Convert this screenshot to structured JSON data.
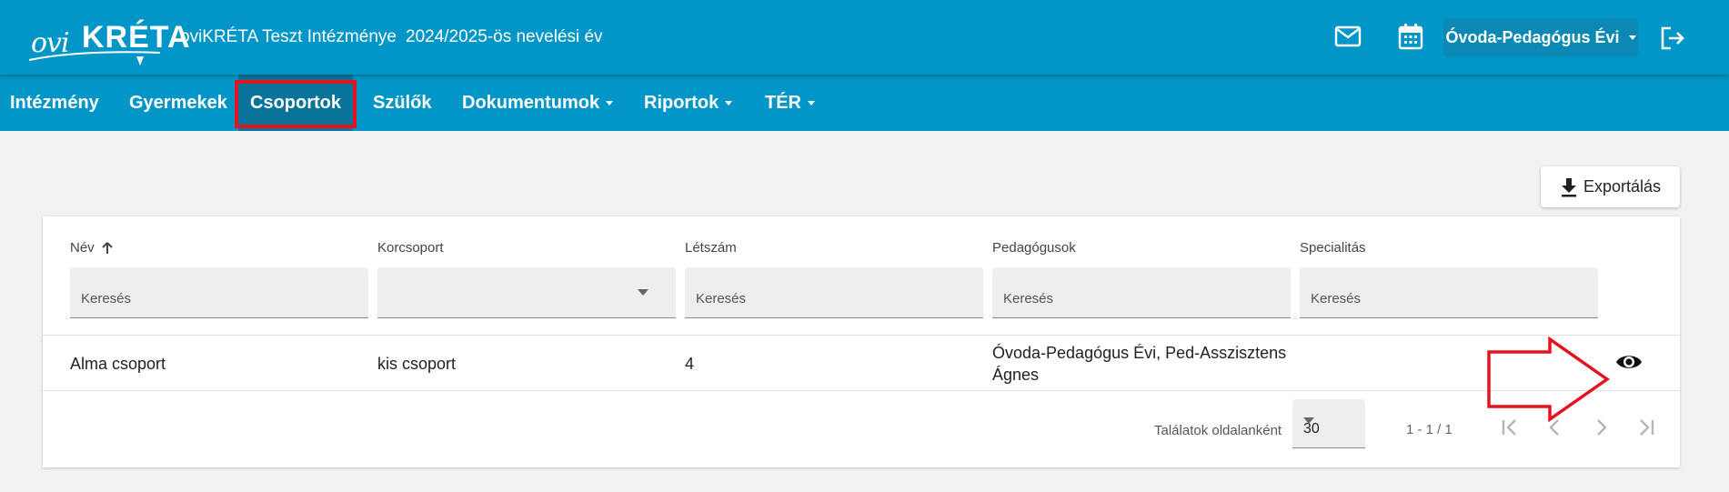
{
  "header": {
    "logo": {
      "prefix": "ovi",
      "brand": "KRÉTA"
    },
    "institution": "oviKRÉTA Teszt Intézménye",
    "school_year": "2024/2025-ös nevelési év",
    "user": "Óvoda-Pedagógus Évi",
    "icons": [
      "mail-icon",
      "calendar-icon",
      "logout-icon"
    ]
  },
  "nav": {
    "items": [
      {
        "label": "Intézmény"
      },
      {
        "label": "Gyermekek"
      },
      {
        "label": "Csoportok",
        "active": true
      },
      {
        "label": "Szülők"
      },
      {
        "label": "Dokumentumok",
        "dropdown": true
      },
      {
        "label": "Riportok",
        "dropdown": true
      },
      {
        "label": "TÉR",
        "dropdown": true
      }
    ]
  },
  "toolbar": {
    "export_label": "Exportálás"
  },
  "table": {
    "columns": [
      {
        "label": "Név",
        "sort": "asc",
        "filter_placeholder": "Keresés"
      },
      {
        "label": "Korcsoport",
        "filter_type": "select",
        "filter_value": ""
      },
      {
        "label": "Létszám",
        "filter_placeholder": "Keresés"
      },
      {
        "label": "Pedagógusok",
        "filter_placeholder": "Keresés"
      },
      {
        "label": "Specialitás",
        "filter_placeholder": "Keresés"
      }
    ],
    "rows": [
      {
        "nev": "Alma csoport",
        "korcsoport": "kis csoport",
        "letszam": "4",
        "pedagogusok_line1": "Óvoda-Pedagógus Évi, Ped-Asszisztens",
        "pedagogusok_line2": "Ágnes",
        "specialitas": ""
      }
    ]
  },
  "pagination": {
    "page_size_label": "Találatok oldalanként",
    "page_size": "30",
    "range": "1 - 1 / 1"
  },
  "colors": {
    "header_bg": "#0196c7",
    "active_nav_bg": "#0a7399",
    "annotation_red": "#e3141e"
  }
}
